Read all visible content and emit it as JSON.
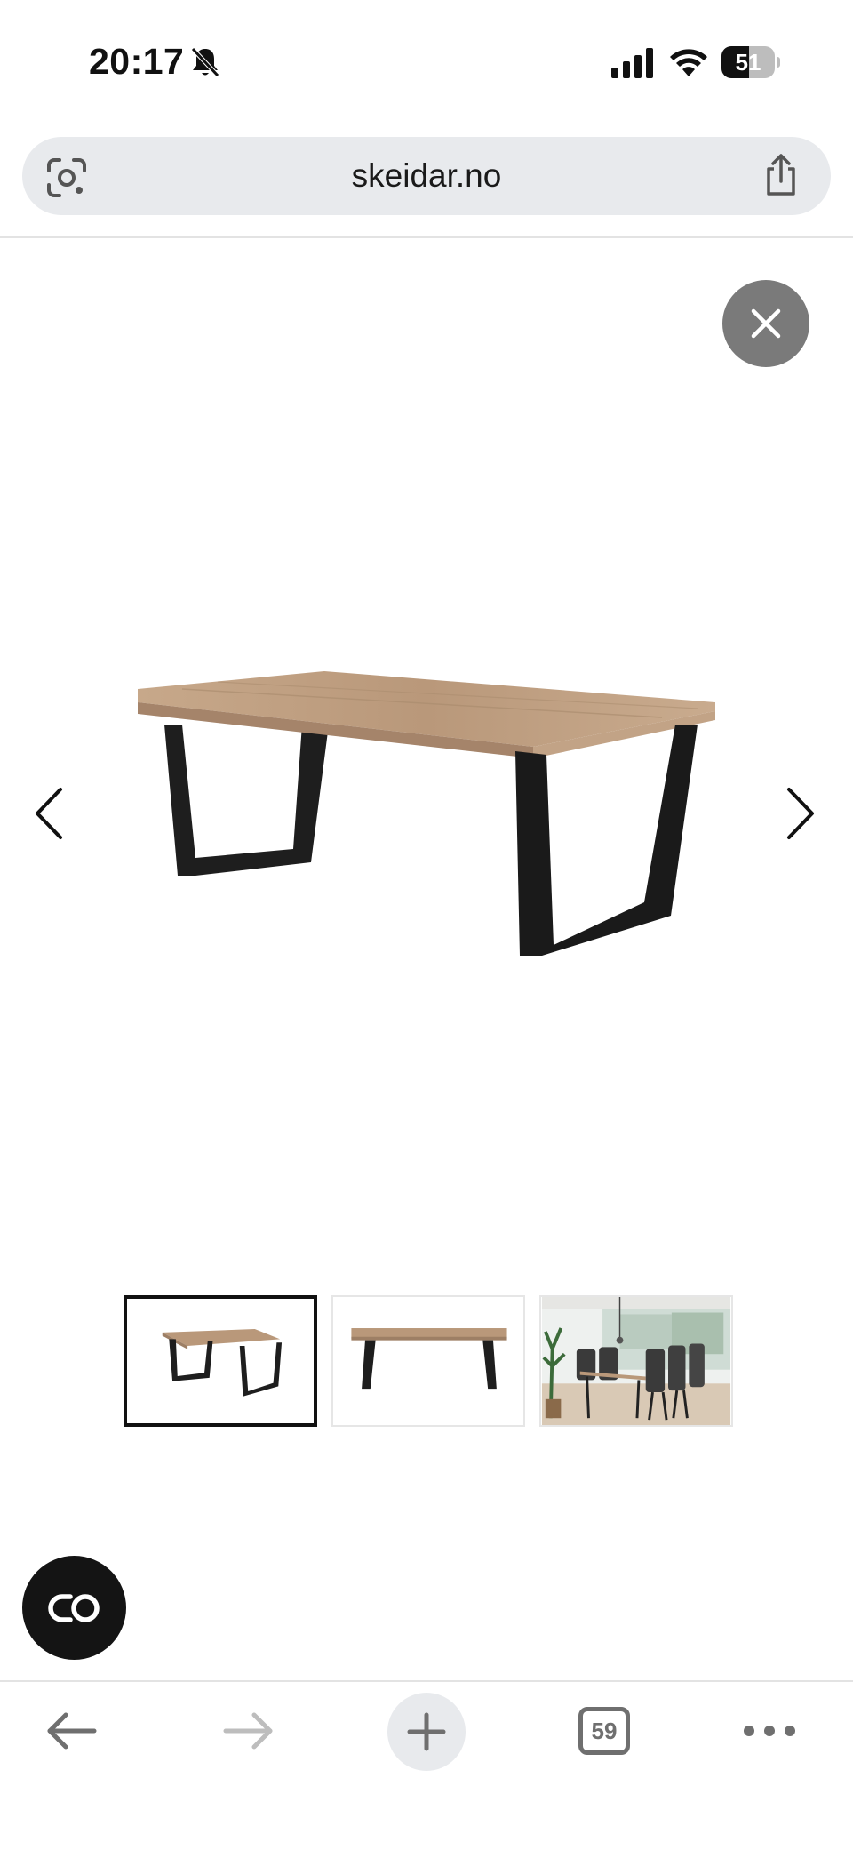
{
  "status_bar": {
    "time": "20:17",
    "battery_level": "51",
    "battery_fraction": 0.51,
    "icons": [
      "bell-slash-icon",
      "signal-icon",
      "wifi-icon",
      "battery-icon"
    ]
  },
  "browser": {
    "url": "skeidar.no",
    "tab_count": "59",
    "icons": [
      "lens-icon",
      "share-icon",
      "back-arrow-icon",
      "forward-arrow-icon",
      "plus-icon",
      "tabs-icon",
      "more-icon"
    ]
  },
  "gallery": {
    "thumbnails": [
      {
        "name": "thumbnail-table-angled",
        "active": true
      },
      {
        "name": "thumbnail-table-front",
        "active": false
      },
      {
        "name": "thumbnail-table-room",
        "active": false
      }
    ],
    "icons": [
      "close-icon",
      "chevron-left-icon",
      "chevron-right-icon",
      "link-icon"
    ]
  },
  "colors": {
    "wood": "#b39374",
    "metal": "#1e1e1e",
    "close_button": "#7a7a7a",
    "fab": "#141414"
  }
}
